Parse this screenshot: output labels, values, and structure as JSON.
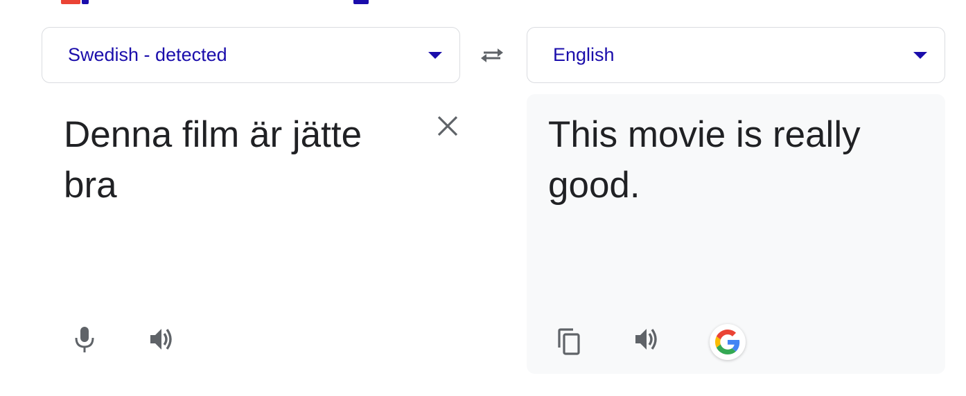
{
  "source": {
    "language_label": "Swedish - detected",
    "text": "Denna film är jätte\nbra"
  },
  "target": {
    "language_label": "English",
    "text": "This movie is really\ngood."
  },
  "icons": {
    "swap": "swap-languages-icon",
    "clear": "close-icon",
    "mic": "microphone-icon",
    "speaker": "speaker-icon",
    "copy": "copy-icon",
    "google": "google-logo-icon"
  },
  "colors": {
    "link_blue": "#1a0dab",
    "panel_bg": "#f8f9fa",
    "icon_gray": "#5f6368",
    "text": "#202124"
  }
}
